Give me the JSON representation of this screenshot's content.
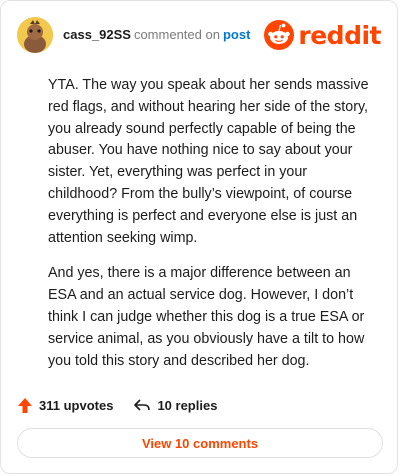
{
  "header": {
    "username": "cass_92SS",
    "commented_on": "commented on",
    "post_link": "post",
    "logo_text": "reddit"
  },
  "comment": {
    "paragraphs": [
      "YTA. The way you speak about her sends massive red flags, and without hearing her side of the story, you already sound perfectly capable of being the abuser. You have nothing nice to say about your sister. Yet, everything was perfect in your childhood? From the bully’s viewpoint, of course everything is perfect and everyone else is just an attention seeking wimp.",
      "And yes, there is a major difference between an ESA and an actual service dog. However, I don’t think I can judge whether this dog is a true ESA or service animal, as you obviously have a tilt to how you told this story and described her dog."
    ]
  },
  "actions": {
    "upvotes": "311 upvotes",
    "replies": "10 replies",
    "view_comments": "View 10 comments"
  },
  "colors": {
    "brand": "#ff4500",
    "link": "#0079d3",
    "avatar_bg": "#f2c94c"
  },
  "icons": {
    "upvote": "upvote-arrow-icon",
    "reply": "reply-arrow-icon",
    "logo": "reddit-snoo-icon"
  }
}
